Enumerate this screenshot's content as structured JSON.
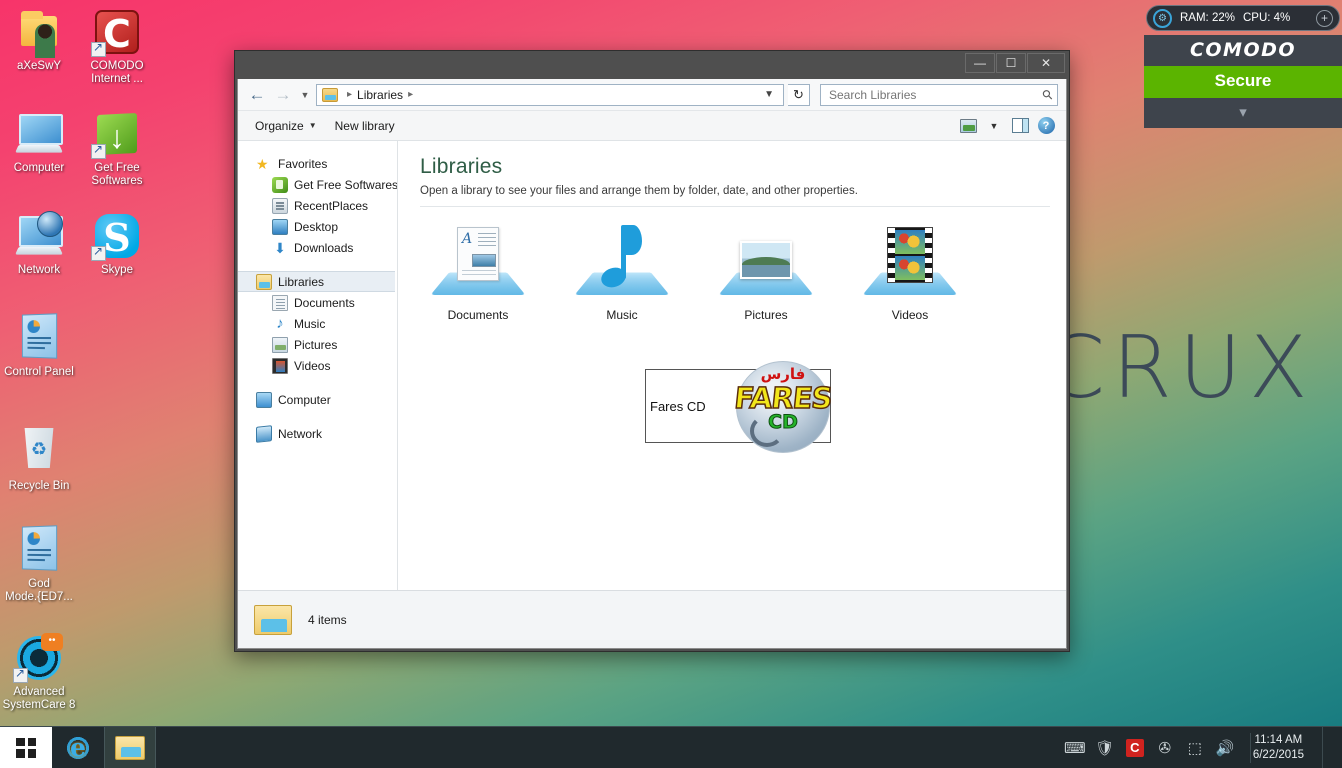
{
  "desktop": {
    "wallpaper_word": "CRUX",
    "icons": [
      {
        "label": "aXeSwY",
        "icon": "folder-user-icon",
        "shortcut": false
      },
      {
        "label": "COMODO\nInternet ...",
        "icon": "comodo-internet-security-icon",
        "shortcut": true
      },
      {
        "label": "Computer",
        "icon": "computer-icon",
        "shortcut": false
      },
      {
        "label": "Get Free\nSoftwares",
        "icon": "get-free-softwares-icon",
        "shortcut": true
      },
      {
        "label": "Network",
        "icon": "network-icon",
        "shortcut": false
      },
      {
        "label": "Skype",
        "icon": "skype-icon",
        "shortcut": true
      },
      {
        "label": "Control Panel",
        "icon": "control-panel-icon",
        "shortcut": false
      },
      {
        "label": "Recycle Bin",
        "icon": "recycle-bin-icon",
        "shortcut": false
      },
      {
        "label": "God\nMode.{ED7...",
        "icon": "god-mode-icon",
        "shortcut": false
      },
      {
        "label": "Advanced\nSystemCare 8",
        "icon": "advanced-systemcare-icon",
        "shortcut": true
      }
    ]
  },
  "comodo_widget": {
    "ram_label": "RAM: 22%",
    "cpu_label": "CPU: 4%",
    "dial_icon": "gauge-icon",
    "plus_icon": "plus-icon",
    "brand": "COMODO",
    "status": "Secure",
    "status_color": "#5bb400",
    "drawer_icon": "chevron-down-icon"
  },
  "window": {
    "titlebar": {
      "minimize": "—",
      "maximize": "☐",
      "close": "✕"
    },
    "address_bar": {
      "back_icon": "back-arrow-icon",
      "forward_icon": "forward-arrow-icon",
      "history_icon": "chevron-down-icon",
      "crumb_icon": "libraries-folder-icon",
      "crumb": "Libraries",
      "sep1": "▸",
      "sep2": "▸",
      "dropdown_icon": "chevron-down-icon",
      "refresh_icon": "refresh-icon"
    },
    "search": {
      "placeholder": "Search Libraries",
      "value": "",
      "icon": "search-icon"
    },
    "command_bar": {
      "organize": "Organize",
      "organize_caret": "▾",
      "new_library": "New library",
      "view_icon": "change-view-icon",
      "view_caret": "▾",
      "preview_pane_icon": "preview-pane-icon",
      "help_icon": "help-icon",
      "help_glyph": "?"
    },
    "nav_pane": [
      {
        "label": "Favorites",
        "icon": "star-icon",
        "level": 0,
        "selected": false
      },
      {
        "label": "Get Free Softwares",
        "icon": "get-free-softwares-icon",
        "level": 1,
        "selected": false
      },
      {
        "label": "RecentPlaces",
        "icon": "recent-places-icon",
        "level": 1,
        "selected": false
      },
      {
        "label": "Desktop",
        "icon": "desktop-icon",
        "level": 1,
        "selected": false
      },
      {
        "label": "Downloads",
        "icon": "downloads-icon",
        "level": 1,
        "selected": false
      },
      {
        "label": "Libraries",
        "icon": "libraries-icon",
        "level": 0,
        "selected": true
      },
      {
        "label": "Documents",
        "icon": "documents-library-icon",
        "level": 1,
        "selected": false
      },
      {
        "label": "Music",
        "icon": "music-library-icon",
        "level": 1,
        "selected": false
      },
      {
        "label": "Pictures",
        "icon": "pictures-library-icon",
        "level": 1,
        "selected": false
      },
      {
        "label": "Videos",
        "icon": "videos-library-icon",
        "level": 1,
        "selected": false
      },
      {
        "label": "Computer",
        "icon": "computer-icon",
        "level": 0,
        "selected": false
      },
      {
        "label": "Network",
        "icon": "network-icon",
        "level": 0,
        "selected": false
      }
    ],
    "content": {
      "title": "Libraries",
      "subtitle": "Open a library to see your files and arrange them by folder, date, and other properties.",
      "libraries": [
        {
          "name": "Documents",
          "icon": "documents-library-tile"
        },
        {
          "name": "Music",
          "icon": "music-library-tile"
        },
        {
          "name": "Pictures",
          "icon": "pictures-library-tile"
        },
        {
          "name": "Videos",
          "icon": "videos-library-tile"
        }
      ]
    },
    "popup": {
      "label": "Fares CD",
      "logo_arabic": "فارس",
      "logo_main": "FARES",
      "logo_sub": "CD"
    },
    "details": {
      "count": "4 items",
      "icon": "libraries-folder-icon"
    }
  },
  "taskbar": {
    "start_icon": "start-button-icon",
    "items": [
      {
        "name": "internet-explorer",
        "icon": "internet-explorer-icon",
        "active": false
      },
      {
        "name": "file-explorer",
        "icon": "file-explorer-icon",
        "active": true
      }
    ],
    "tray": [
      {
        "name": "keyboard-layout-icon",
        "glyph": "⌨"
      },
      {
        "name": "security-shield-icon",
        "glyph": "🛡"
      },
      {
        "name": "comodo-tray-icon",
        "glyph": "C"
      },
      {
        "name": "usb-device-icon",
        "glyph": "✇"
      },
      {
        "name": "network-tray-icon",
        "glyph": "⬚"
      },
      {
        "name": "volume-icon",
        "glyph": "🔊"
      }
    ],
    "clock_time": "11:14 AM",
    "clock_date": "6/22/2015"
  }
}
